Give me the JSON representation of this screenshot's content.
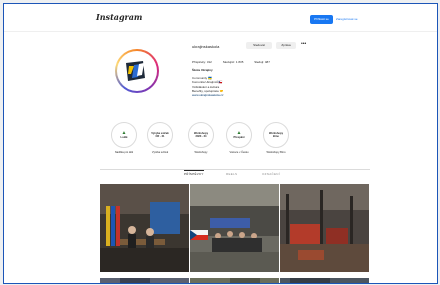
{
  "header": {
    "logo_text": "Instagram",
    "login_label": "Přihlásit se",
    "signup_label": "Zaregistrovat se"
  },
  "profile": {
    "username": "ukrajinskaskola",
    "follow_label": "Sledovat",
    "message_label": "Zpráva",
    "more_label": "•••",
    "posts": "Příspěvky: 312",
    "followers": "Sledující: 1 835",
    "following": "Sleduji: 487",
    "full_name": "Škola Ukrajiny",
    "bio_lines": [
      "Community 🇺🇦",
      "Komunita Ukrajinců 🇨🇿",
      "Vzdělávání a kultura",
      "Benefity, spolupráce 🤝",
      "www.ukrajinskaskola.cz"
    ]
  },
  "highlights": [
    {
      "top": "",
      "bottom": "Lodiě",
      "label": "Nadílka pro děti"
    },
    {
      "top": "Výroba svíček",
      "bottom": "ČR · 21",
      "label": "Výroba svíček"
    },
    {
      "top": "Workshopy",
      "bottom": "2023 · 24",
      "label": "Workshopy"
    },
    {
      "top": "",
      "bottom": "Přespání",
      "label": "Vánoce v Česku"
    },
    {
      "top": "Workshopy",
      "bottom": "Brno",
      "label": "Workshopy Brno"
    }
  ],
  "tabs": [
    {
      "label": "PŘÍSPĚVKY",
      "active": true
    },
    {
      "label": "REELS",
      "active": false
    },
    {
      "label": "OZNAČENÍ",
      "active": false
    }
  ],
  "colors": {
    "accent": "#1877f2",
    "frame_border": "#1c56b8"
  }
}
